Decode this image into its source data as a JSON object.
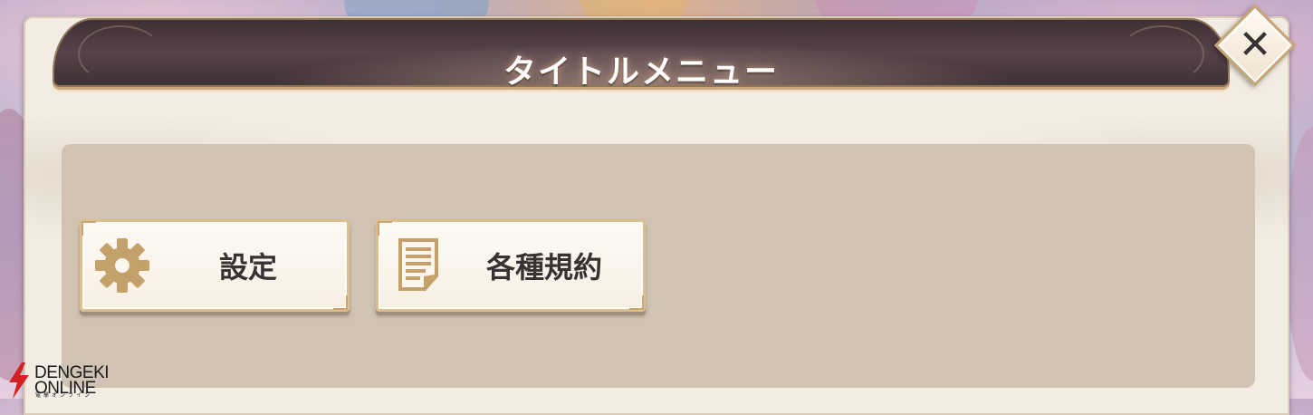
{
  "menu": {
    "title": "タイトルメニュー",
    "buttons": [
      {
        "label": "設定",
        "icon": "gear-icon"
      },
      {
        "label": "各種規約",
        "icon": "document-icon"
      }
    ]
  },
  "close": {
    "icon": "close-icon",
    "glyph": "✕"
  },
  "watermark": {
    "line1": "DENGEKI",
    "line2": "ONLINE",
    "line3": "電撃オンライン"
  },
  "colors": {
    "title_bar": "#4a3a40",
    "panel": "#f3ece2",
    "content": "#d1c3b4",
    "button_border": "#dcbf8f",
    "icon_gold": "#c4a06a",
    "watermark_red": "#d42020"
  }
}
